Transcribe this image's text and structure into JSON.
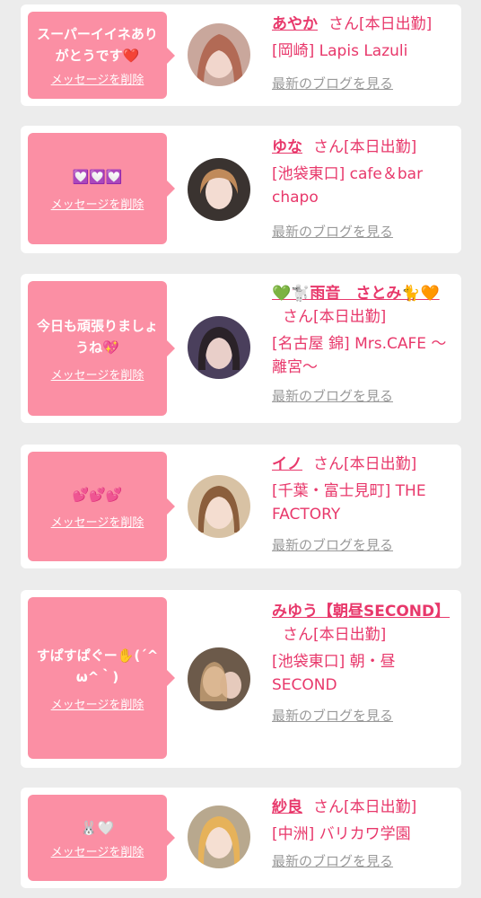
{
  "delete_label": "メッセージを削除",
  "blog_label": "最新のブログを見る",
  "san_suffix": "さん[本日出勤]",
  "accent_color": "#e8386b",
  "bubble_color": "#fb8fa4",
  "messages": [
    {
      "message": "スーパーイイネありがとうです❤️",
      "name": "あやか",
      "shop": "[岡崎] Lapis Lazuli"
    },
    {
      "message": "💟💟💟",
      "name": "ゆな",
      "shop": "[池袋東口] cafe＆bar chapo"
    },
    {
      "message": "今日も頑張りましょうね💖",
      "name": "💚🐩雨音　さとみ🐈🧡",
      "shop": "[名古屋 錦] Mrs.CAFE 〜離宮〜"
    },
    {
      "message": "💕💕💕",
      "name": "イノ",
      "shop": "[千葉・富士見町] THE FACTORY"
    },
    {
      "message": "すぱすぱぐー✋(´^ω^｀)",
      "name": "みゆう【朝昼SECOND】",
      "shop": "[池袋東口] 朝・昼SECOND"
    },
    {
      "message": "🐰🤍",
      "name": "紗良",
      "shop": "[中洲] バリカワ学園"
    }
  ]
}
